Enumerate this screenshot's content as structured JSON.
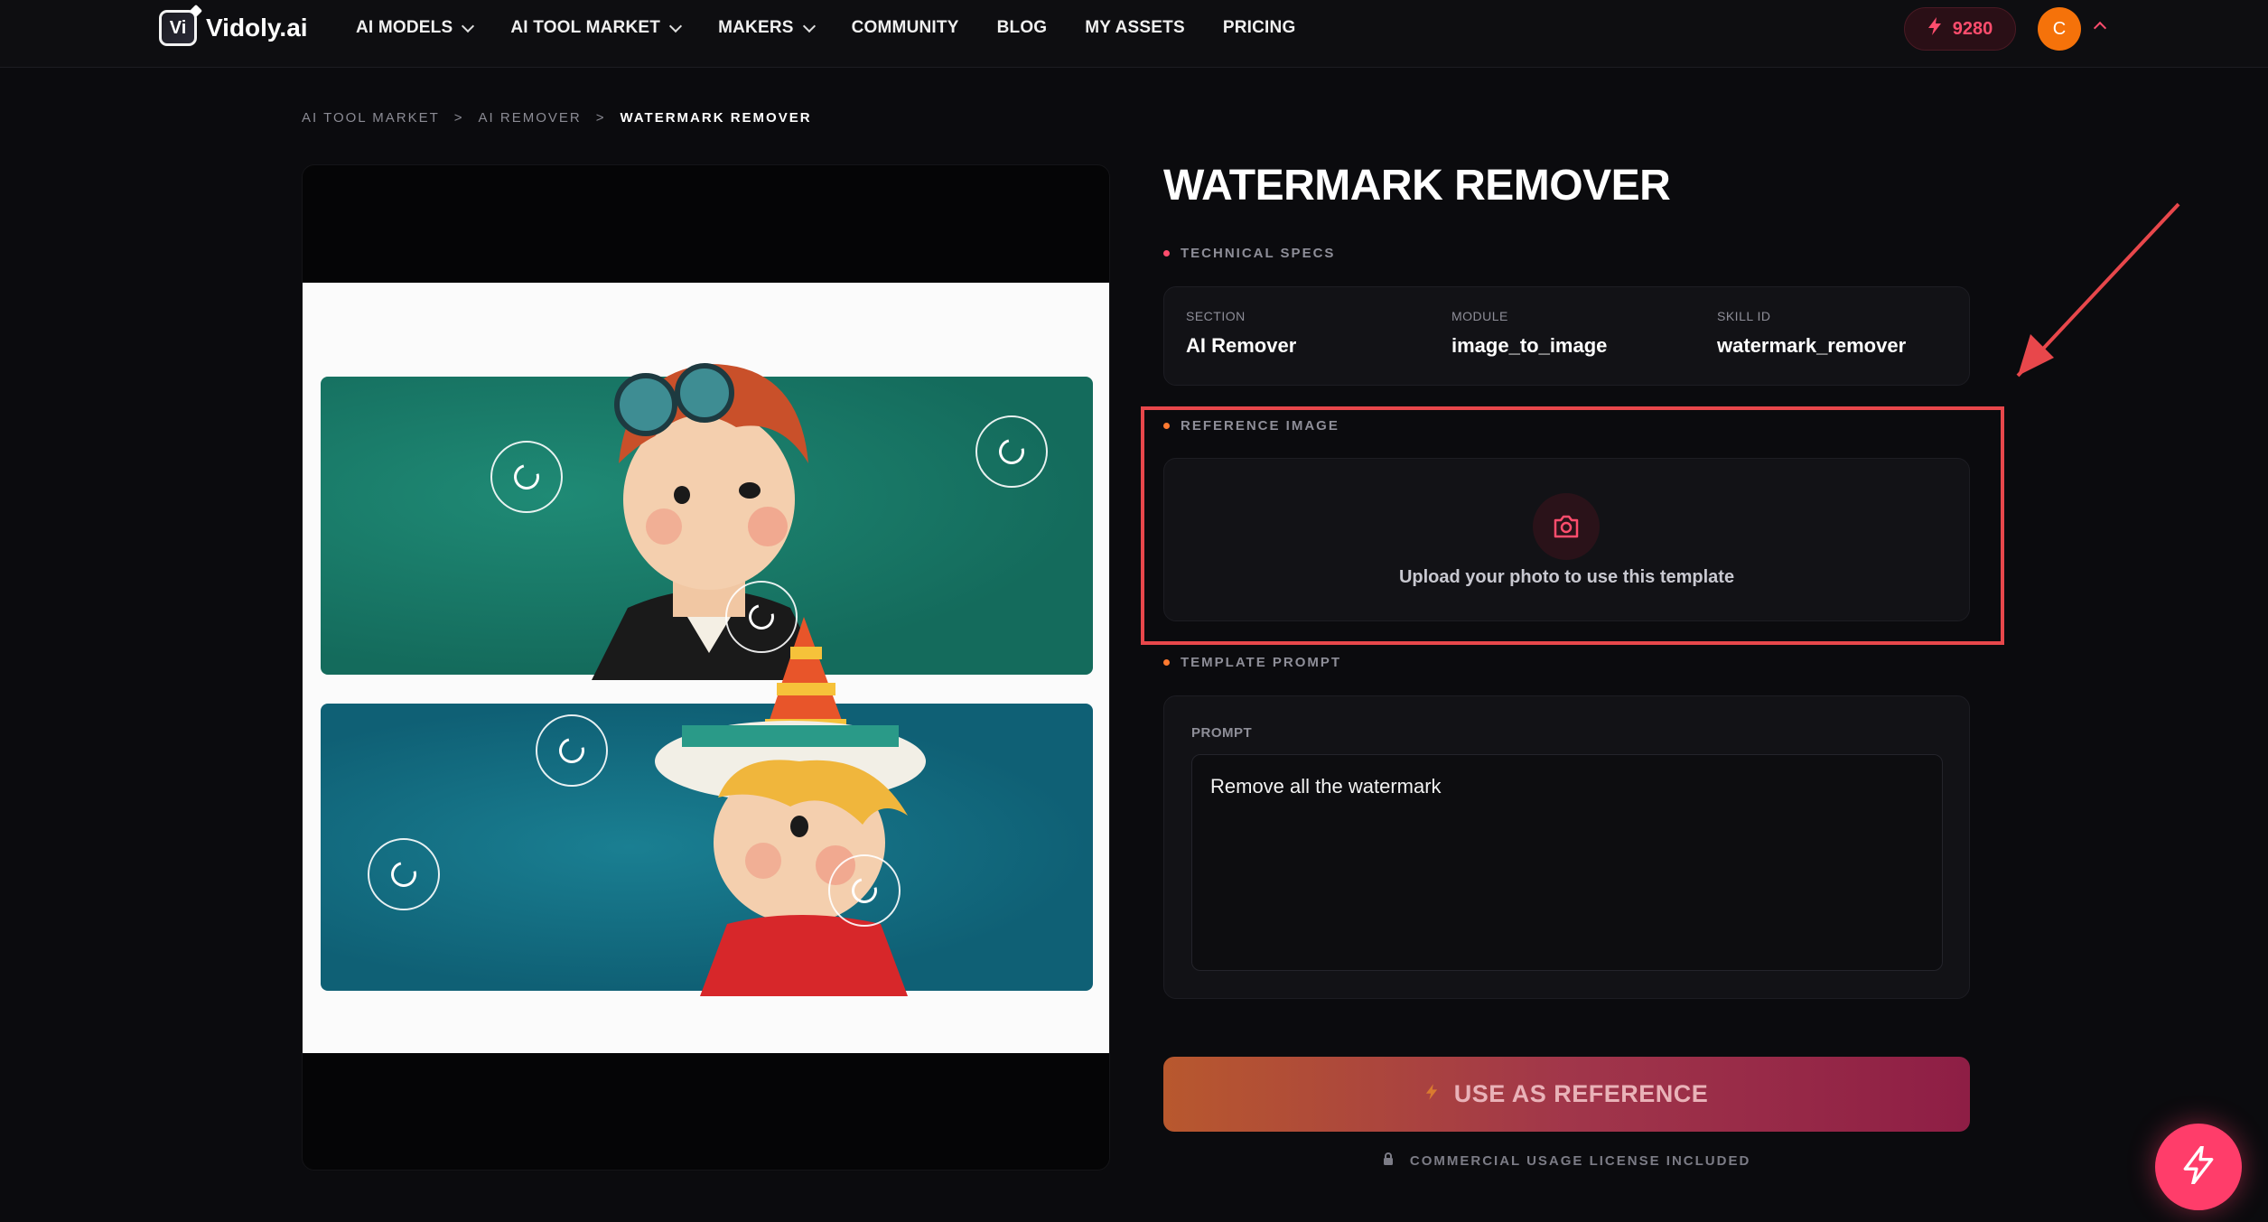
{
  "nav": {
    "logo_mark": "Vi",
    "logo_text": "Vidoly.ai",
    "items": [
      {
        "label": "AI MODELS",
        "dropdown": true
      },
      {
        "label": "AI TOOL MARKET",
        "dropdown": true
      },
      {
        "label": "MAKERS",
        "dropdown": true
      },
      {
        "label": "COMMUNITY",
        "dropdown": false
      },
      {
        "label": "BLOG",
        "dropdown": false
      },
      {
        "label": "MY ASSETS",
        "dropdown": false
      },
      {
        "label": "PRICING",
        "dropdown": false
      }
    ],
    "credits": "9280",
    "avatar_initial": "C"
  },
  "breadcrumb": {
    "items": [
      "AI TOOL MARKET",
      ">",
      "AI REMOVER",
      ">"
    ],
    "current": "WATERMARK REMOVER"
  },
  "title": "WATERMARK REMOVER",
  "technical_specs": {
    "label": "TECHNICAL SPECS",
    "specs": [
      {
        "key": "SECTION",
        "value": "AI Remover"
      },
      {
        "key": "MODULE",
        "value": "image_to_image"
      },
      {
        "key": "SKILL ID",
        "value": "watermark_remover"
      }
    ]
  },
  "reference_image": {
    "label": "REFERENCE IMAGE",
    "upload_text": "Upload your photo to use this template",
    "icon": "camera-icon"
  },
  "template_prompt": {
    "label": "TEMPLATE PROMPT",
    "prompt_label": "PROMPT",
    "prompt_value": "Remove all the watermark"
  },
  "cta": {
    "label": "USE AS REFERENCE",
    "icon": "bolt-icon"
  },
  "license": "COMMERCIAL USAGE LICENSE INCLUDED",
  "colors": {
    "accent": "#ff4d6d",
    "highlight": "#e8474b",
    "background": "#0b0b0e",
    "card": "#121216"
  }
}
